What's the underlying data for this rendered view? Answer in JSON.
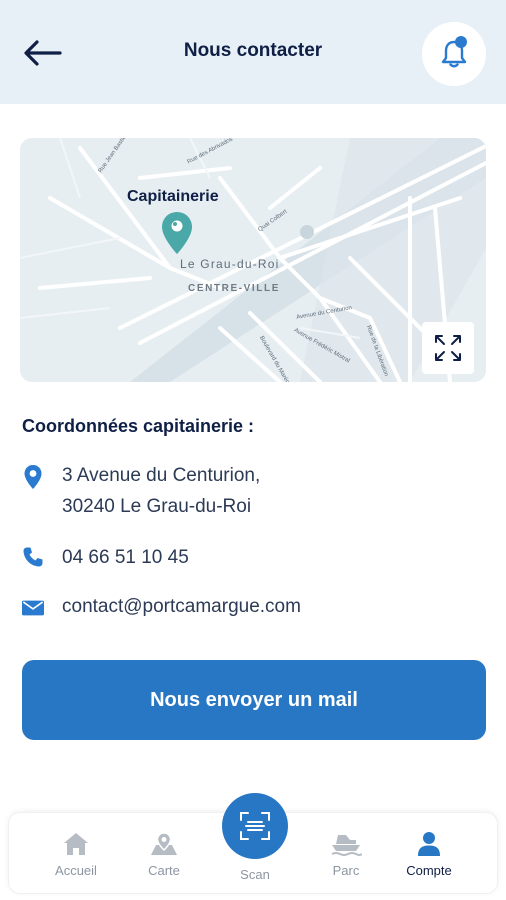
{
  "header": {
    "title": "Nous contacter",
    "accent_color": "#2a7bd0"
  },
  "map": {
    "marker_label": "Capitainerie",
    "city_label": "Le Grau-du-Roi",
    "district_label": "CENTRE-VILLE",
    "street_labels": [
      "Rue des Abrivados",
      "Rue Jean Bastide",
      "Quai Colbert",
      "Avenue du Centurion",
      "Avenue Frédéric Mistral",
      "Rue de la Libération",
      "Boulevard du Maréchal Juin"
    ],
    "marker_color": "#4aa8a8"
  },
  "contact": {
    "section_title": "Coordonnées capitainerie :",
    "address_line1": "3 Avenue du Centurion,",
    "address_line2": "30240 Le Grau-du-Roi",
    "phone": "04 66 51 10 45",
    "email": "contact@portcamargue.com"
  },
  "mail_button": {
    "label": "Nous envoyer un mail",
    "color": "#2877c4"
  },
  "tabbar": {
    "items": [
      {
        "label": "Accueil",
        "icon": "home-icon",
        "active": false
      },
      {
        "label": "Carte",
        "icon": "map-pin-icon",
        "active": false
      },
      {
        "label": "Scan",
        "icon": "scan-icon",
        "active": false
      },
      {
        "label": "Parc",
        "icon": "boat-icon",
        "active": false
      },
      {
        "label": "Compte",
        "icon": "user-icon",
        "active": true
      }
    ]
  }
}
